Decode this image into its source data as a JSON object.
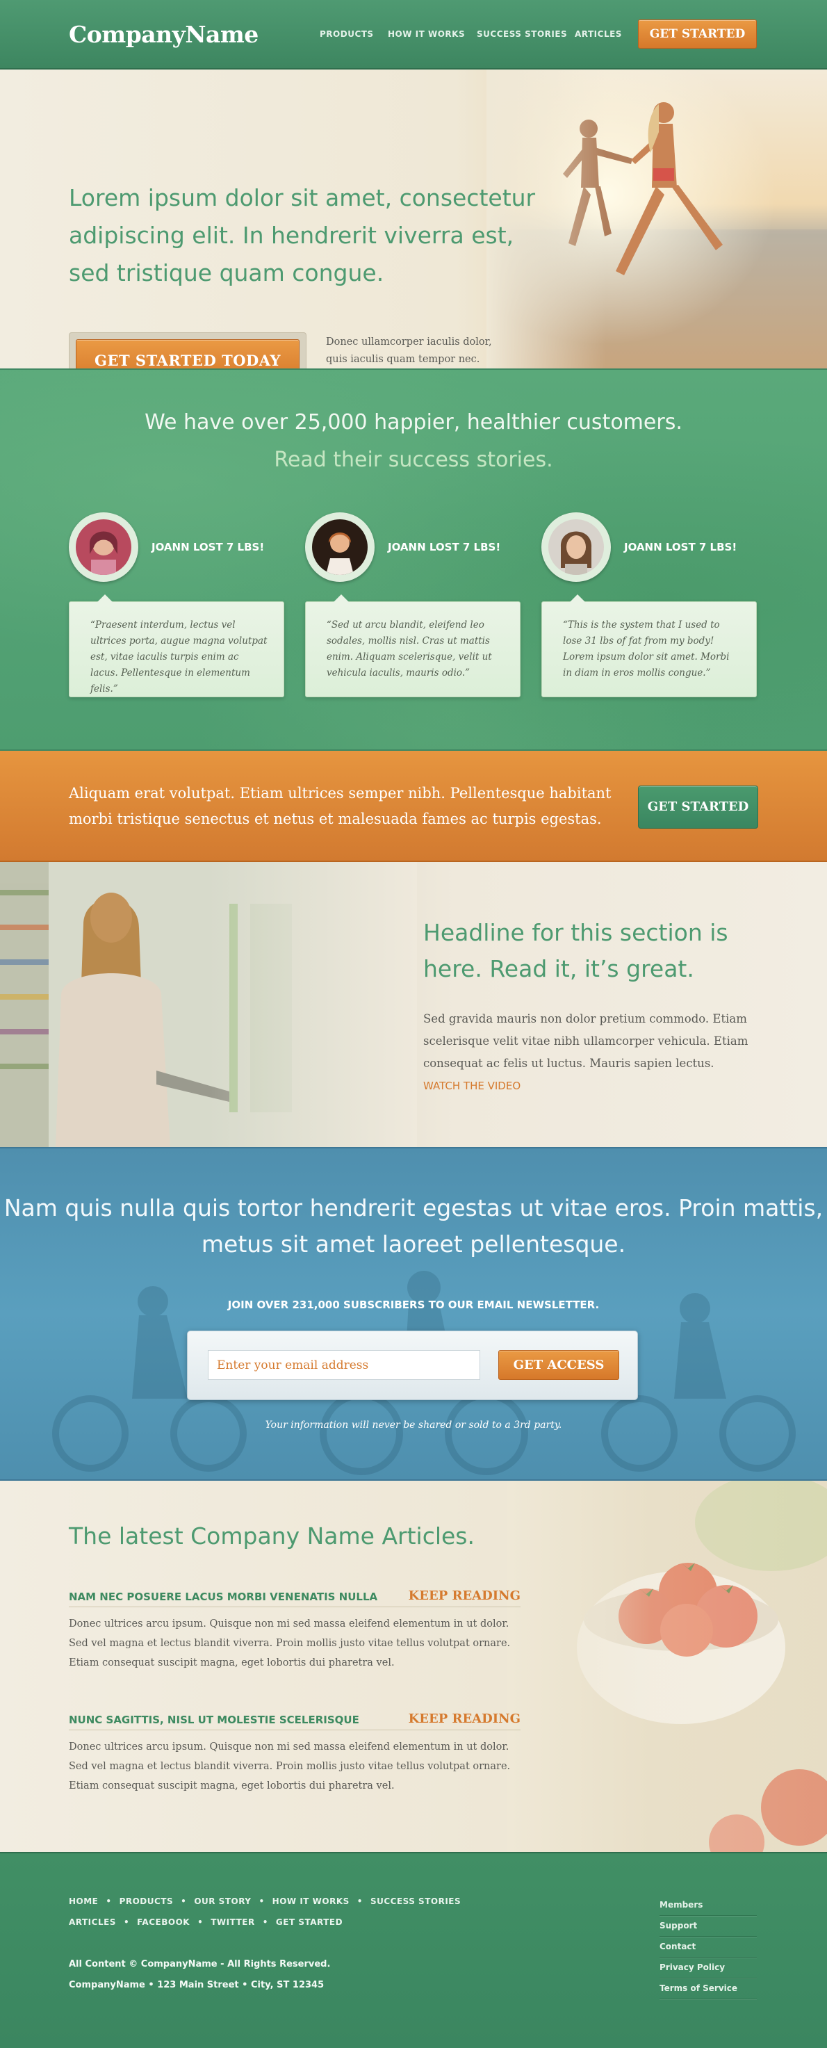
{
  "header": {
    "logo": "CompanyName",
    "nav": [
      "PRODUCTS",
      "HOW IT WORKS",
      "SUCCESS STORIES",
      "ARTICLES"
    ],
    "cta": "GET STARTED"
  },
  "hero": {
    "title": "Lorem ipsum dolor sit amet, consectetur adipiscing elit. In hendrerit viverra est, sed tristique quam congue.",
    "cta": "GET STARTED TODAY",
    "text": "Donec ullamcorper iaculis dolor, quis iaculis quam tempor nec.  Praesent interdum."
  },
  "testimonials": {
    "heading": "We have over 25,000 happier, healthier customers.",
    "subheading": "Read their success stories.",
    "items": [
      {
        "name": "JOANN LOST 7 LBS!",
        "quote": "“Praesent interdum, lectus vel ultrices porta, augue magna volutpat est, vitae iaculis turpis enim ac lacus. Pellentesque in elementum felis.”"
      },
      {
        "name": "JOANN LOST 7 LBS!",
        "quote": "“Sed ut arcu blandit, eleifend leo sodales, mollis nisl. Cras ut mattis enim. Aliquam scelerisque, velit ut vehicula iaculis, mauris odio.”"
      },
      {
        "name": "JOANN LOST 7 LBS!",
        "quote": "“This is the system that I used to lose 31 lbs of fat from my body! Lorem ipsum dolor sit amet. Morbi in diam in eros mollis congue.”"
      }
    ]
  },
  "band": {
    "text": "Aliquam erat volutpat. Etiam ultrices semper nibh. Pellentesque habitant morbi tristique senectus et netus et malesuada fames ac turpis egestas.",
    "cta": "GET STARTED"
  },
  "video": {
    "title": "Headline for this section is here. Read it, it’s great.",
    "text": "Sed gravida mauris non dolor pretium commodo. Etiam scelerisque velit vitae nibh ullamcorper vehicula. Etiam consequat ac felis ut luctus. Mauris sapien lectus.",
    "link": "WATCH THE VIDEO"
  },
  "newsletter": {
    "title": "Nam quis nulla quis tortor hendrerit egestas ut vitae eros. Proin mattis, metus sit amet laoreet pellentesque.",
    "subtitle": "JOIN OVER 231,000 SUBSCRIBERS TO OUR EMAIL NEWSLETTER.",
    "placeholder": "Enter your email address",
    "value": "",
    "button": "GET ACCESS",
    "note": "Your information will never be shared or sold to a 3rd party."
  },
  "articles": {
    "title": "The latest Company Name Articles.",
    "items": [
      {
        "title": "NAM NEC POSUERE LACUS MORBI VENENATIS NULLA",
        "more": "KEEP READING",
        "body": "Donec ultrices arcu ipsum. Quisque non mi sed massa eleifend elementum in ut dolor. Sed vel magna et lectus blandit viverra. Proin mollis justo vitae tellus volutpat ornare. Etiam consequat suscipit magna, eget lobortis dui pharetra vel."
      },
      {
        "title": "NUNC SAGITTIS, NISL UT MOLESTIE SCELERISQUE",
        "more": "KEEP READING",
        "body": "Donec ultrices arcu ipsum. Quisque non mi sed massa eleifend elementum in ut dolor. Sed vel magna et lectus blandit viverra. Proin mollis justo vitae tellus volutpat ornare. Etiam consequat suscipit magna, eget lobortis dui pharetra vel."
      }
    ]
  },
  "footer": {
    "nav_row1": [
      "HOME",
      "PRODUCTS",
      "OUR STORY",
      "HOW IT WORKS",
      "SUCCESS STORIES"
    ],
    "nav_row2": [
      "ARTICLES",
      "FACEBOOK",
      "TWITTER",
      "GET STARTED"
    ],
    "separator": "•",
    "copyright": "All Content © CompanyName - All Rights Reserved.",
    "address": "CompanyName • 123 Main Street • City, ST 12345",
    "links": [
      "Members",
      "Support",
      "Contact",
      "Privacy Policy",
      "Terms of Service"
    ]
  },
  "colors": {
    "brand_green": "#4d9a70",
    "accent_orange": "#d57a2e",
    "newsletter_blue": "#5a9fbe"
  }
}
